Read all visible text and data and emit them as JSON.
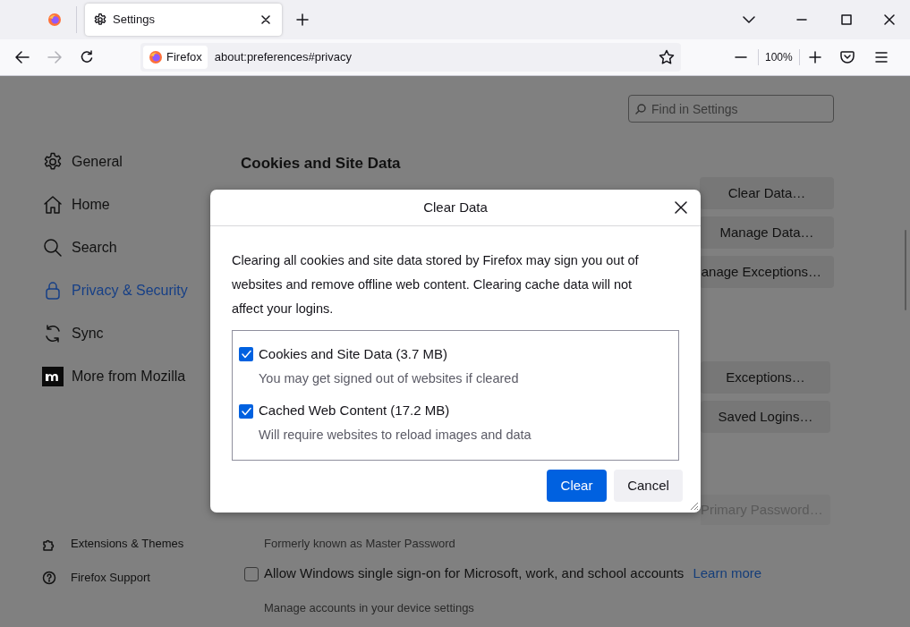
{
  "tabs": [
    {
      "kind": "pinned",
      "selected": false
    },
    {
      "kind": "page",
      "label": "Settings",
      "selected": true
    }
  ],
  "toolbar": {
    "identity_label": "Firefox",
    "url": "about:preferences#privacy",
    "zoom": "100%"
  },
  "search": {
    "placeholder": "Find in Settings"
  },
  "sidebar": {
    "items": [
      {
        "label": "General",
        "selected": false
      },
      {
        "label": "Home",
        "selected": false
      },
      {
        "label": "Search",
        "selected": false
      },
      {
        "label": "Privacy & Security",
        "selected": true
      },
      {
        "label": "Sync",
        "selected": false
      },
      {
        "label": "More from Mozilla",
        "selected": false
      }
    ],
    "footer_items": [
      {
        "label": "Extensions & Themes"
      },
      {
        "label": "Firefox Support"
      }
    ]
  },
  "content": {
    "heading": "Cookies and Site Data",
    "buttons": [
      "Clear Data…",
      "Manage Data…",
      "anage Exceptions…"
    ],
    "buttons_2": [
      "Exceptions…",
      "Saved Logins…"
    ],
    "options": [
      {
        "note": "Formerly known as Master Password",
        "button": {
          "label": "Primary Password…",
          "disabled": true
        }
      },
      {
        "label": "Allow Windows single sign-on for Microsoft, work, and school accounts",
        "link": "Learn more",
        "checked": false,
        "note": "Manage accounts in your device settings"
      }
    ]
  },
  "dialog": {
    "title": "Clear Data",
    "message": "Clearing all cookies and site data stored by Firefox may sign you out of websites and remove offline web content. Clearing cache data will not affect your logins.",
    "options": [
      {
        "label": "Cookies and Site Data (3.7 MB)",
        "note": "You may get signed out of websites if cleared",
        "checked": true
      },
      {
        "label": "Cached Web Content (17.2 MB)",
        "note": "Will require websites to reload images and data",
        "checked": true
      }
    ],
    "buttons": [
      {
        "label": "Clear",
        "kind": "primary"
      },
      {
        "label": "Cancel",
        "kind": "secondary"
      }
    ]
  }
}
